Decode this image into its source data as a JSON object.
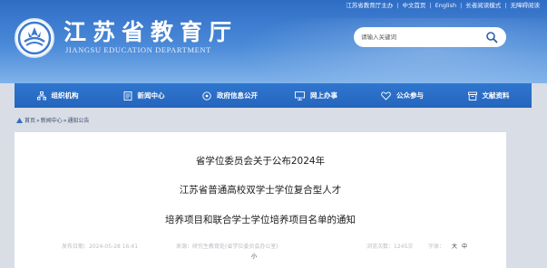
{
  "top_links": [
    "江苏省教育厅主办",
    "中文首页",
    "English",
    "长者阅读模式",
    "无障碍阅读"
  ],
  "site": {
    "title_cn": "江苏省教育厅",
    "title_en": "JIANGSU EDUCATION DEPARTMENT"
  },
  "search": {
    "placeholder": "请输入关键词"
  },
  "nav": [
    {
      "label": "组织机构",
      "icon": "org-chart-icon"
    },
    {
      "label": "新闻中心",
      "icon": "news-icon"
    },
    {
      "label": "政府信息公开",
      "icon": "info-disclosure-icon"
    },
    {
      "label": "网上办事",
      "icon": "online-service-icon"
    },
    {
      "label": "公众参与",
      "icon": "heart-icon"
    },
    {
      "label": "文献资料",
      "icon": "archive-icon"
    }
  ],
  "breadcrumb": [
    "首页",
    "新闻中心",
    "通知公告"
  ],
  "article": {
    "title_lines": [
      "省学位委员会关于公布2024年",
      "江苏省普通高校双学士学位复合型人才",
      "培养项目和联合学士学位培养项目名单的通知"
    ],
    "meta": {
      "date_label": "发布日期：2024-05-28 16:41",
      "source_label": "来源：研究生教育处(省学位委员会办公室)",
      "views_label": "浏览次数：1245次",
      "font_label": "字体：",
      "font_large": "大",
      "font_medium": "中",
      "font_small": "小"
    }
  },
  "colors": {
    "header_top": "#2f6dc5",
    "nav_bg": "#2565bd",
    "page_bg": "#d9dde5"
  }
}
